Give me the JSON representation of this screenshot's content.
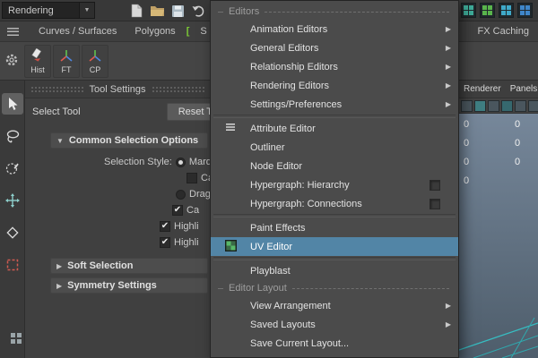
{
  "colors": {
    "highlight_blue": "#5285a6",
    "grid_teal": "#2fb3b8",
    "viewport_top": "#76879a",
    "viewport_bottom": "#4e5d6b"
  },
  "statusline": {
    "menu_selector": {
      "value": "Rendering"
    },
    "file_icons": [
      "new-scene-icon",
      "open-scene-icon",
      "save-scene-icon",
      "undo-icon",
      "redo-icon"
    ],
    "right_icons": [
      "grid-panel-icon-1",
      "grid-panel-icon-2",
      "grid-panel-icon-3",
      "grid-panel-icon-4"
    ]
  },
  "shelf": {
    "tabs_left": [
      {
        "label": "Curves / Surfaces"
      },
      {
        "label": "Polygons"
      },
      {
        "label": "S"
      }
    ],
    "tabs_marker": "[",
    "tabs_right": [
      {
        "label": "FX"
      },
      {
        "label": "FX Caching"
      }
    ],
    "buttons": [
      {
        "label": "Hist",
        "icon": "marker-icon"
      },
      {
        "label": "FT",
        "icon": "axis-tripod-icon"
      },
      {
        "label": "CP",
        "icon": "axis-tripod-icon"
      }
    ]
  },
  "toolbox": [
    "select-tool",
    "lasso-tool",
    "paint-selection-tool",
    "move-tool",
    "rotate-tool",
    "scale-tool",
    "last-tool"
  ],
  "tool_settings": {
    "panel_title": "Tool Settings",
    "tool_name": "Select Tool",
    "reset_button_label": "Reset T",
    "selection_style_label": "Selection Style:",
    "option_rows": [
      {
        "control": "radio",
        "checked": true,
        "label": "Marq"
      },
      {
        "control": "checkbox",
        "checked": false,
        "label": "Ca"
      },
      {
        "control": "radio",
        "checked": false,
        "label": "Drag"
      },
      {
        "control": "checkbox",
        "checked": true,
        "label": "Ca"
      },
      {
        "control": "checkbox",
        "checked": true,
        "label": "Highli"
      },
      {
        "control": "checkbox",
        "checked": true,
        "label": "Highli"
      }
    ],
    "sections": [
      {
        "label": "Common Selection Options",
        "expanded": true
      },
      {
        "label": "Soft Selection",
        "expanded": false
      },
      {
        "label": "Symmetry Settings",
        "expanded": false
      }
    ]
  },
  "menu": {
    "group1_label": "Editors",
    "group2_label": "Editor Layout",
    "items": [
      {
        "label": "Animation Editors",
        "submenu": true
      },
      {
        "label": "General Editors",
        "submenu": true
      },
      {
        "label": "Relationship Editors",
        "submenu": true
      },
      {
        "label": "Rendering Editors",
        "submenu": true
      },
      {
        "label": "Settings/Preferences",
        "submenu": true
      },
      {
        "label": "Attribute Editor"
      },
      {
        "label": "Outliner"
      },
      {
        "label": "Node Editor"
      },
      {
        "label": "Hypergraph: Hierarchy",
        "checkbox": true,
        "checked": false
      },
      {
        "label": "Hypergraph: Connections",
        "checkbox": true,
        "checked": false
      },
      {
        "label": "Paint Effects"
      },
      {
        "label": "UV Editor",
        "highlighted": true
      },
      {
        "label": "Playblast"
      },
      {
        "label": "View Arrangement",
        "submenu": true
      },
      {
        "label": "Saved Layouts",
        "submenu": true
      },
      {
        "label": "Save Current Layout..."
      }
    ]
  },
  "viewport": {
    "menu_items": [
      {
        "label": "Renderer"
      },
      {
        "label": "Panels"
      }
    ],
    "channel_values": [
      {
        "left": "0",
        "right": "0"
      },
      {
        "left": "0",
        "right": "0"
      },
      {
        "left": "0",
        "right": "0"
      },
      {
        "left": "0",
        "right": ""
      }
    ]
  }
}
